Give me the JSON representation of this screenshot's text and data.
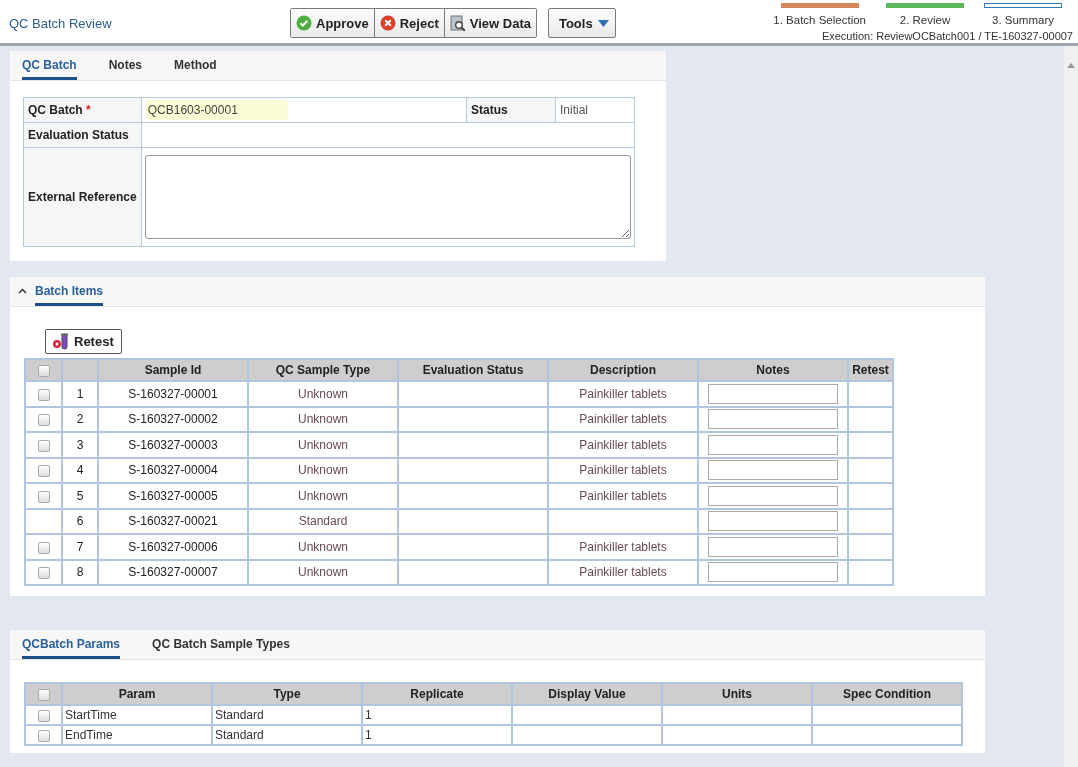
{
  "header": {
    "title": "QC Batch Review",
    "toolbar": [
      {
        "label": "Approve",
        "kind": "approve"
      },
      {
        "label": "Reject",
        "kind": "reject"
      },
      {
        "label": "View Data",
        "kind": "view"
      }
    ],
    "tools_menu": {
      "label": "Tools"
    },
    "steps": [
      {
        "label": "1. Batch Selection",
        "color": "#d4875a",
        "filled": true
      },
      {
        "label": "2. Review",
        "color": "#5cb85c",
        "filled": true
      },
      {
        "label": "3. Summary",
        "color": "#3c7ab5",
        "filled": false
      }
    ],
    "execution": "Execution: ReviewOCBatch001 / TE-160327-00007"
  },
  "batch_panel": {
    "tabs": [
      {
        "label": "QC Batch",
        "selected": true
      },
      {
        "label": "Notes",
        "selected": false
      },
      {
        "label": "Method",
        "selected": false
      }
    ],
    "qc_batch_label": "QC Batch",
    "required_mark": "*",
    "qc_batch_value": "QCB1603-00001",
    "status_label": "Status",
    "status_value": "Initial",
    "evaluation_status_label": "Evaluation Status",
    "external_reference_label": "External Reference"
  },
  "batch_items": {
    "title": "Batch Items",
    "expanded": true,
    "retest_button": "Retest",
    "select_all_checked": false,
    "columns": [
      "Sample Id",
      "QC Sample Type",
      "Evaluation Status",
      "Description",
      "Notes",
      "Retest"
    ],
    "rows": [
      {
        "has_checkbox": true,
        "checked": false,
        "number": "1",
        "sample_id": "S-160327-00001",
        "qc_sample_type": "Unknown",
        "description": "Painkiller tablets"
      },
      {
        "has_checkbox": true,
        "checked": false,
        "number": "2",
        "sample_id": "S-160327-00002",
        "qc_sample_type": "Unknown",
        "description": "Painkiller tablets"
      },
      {
        "has_checkbox": true,
        "checked": false,
        "number": "3",
        "sample_id": "S-160327-00003",
        "qc_sample_type": "Unknown",
        "description": "Painkiller tablets"
      },
      {
        "has_checkbox": true,
        "checked": false,
        "number": "4",
        "sample_id": "S-160327-00004",
        "qc_sample_type": "Unknown",
        "description": "Painkiller tablets"
      },
      {
        "has_checkbox": true,
        "checked": false,
        "number": "5",
        "sample_id": "S-160327-00005",
        "qc_sample_type": "Unknown",
        "description": "Painkiller tablets"
      },
      {
        "has_checkbox": false,
        "number": "6",
        "sample_id": "S-160327-00021",
        "qc_sample_type": "Standard",
        "description": ""
      },
      {
        "has_checkbox": true,
        "checked": false,
        "number": "7",
        "sample_id": "S-160327-00006",
        "qc_sample_type": "Unknown",
        "description": "Painkiller tablets"
      },
      {
        "has_checkbox": true,
        "checked": false,
        "number": "8",
        "sample_id": "S-160327-00007",
        "qc_sample_type": "Unknown",
        "description": "Painkiller tablets"
      }
    ]
  },
  "params_panel": {
    "tabs": [
      {
        "label": "QCBatch Params",
        "selected": true
      },
      {
        "label": "QC Batch Sample Types",
        "selected": false
      }
    ],
    "select_all_checked": false,
    "columns": [
      "Param",
      "Type",
      "Replicate",
      "Display Value",
      "Units",
      "Spec Condition"
    ],
    "rows": [
      {
        "checked": false,
        "param": "StartTime",
        "type": "Standard",
        "replicate": "1"
      },
      {
        "checked": false,
        "param": "EndTime",
        "type": "Standard",
        "replicate": "1"
      }
    ]
  }
}
